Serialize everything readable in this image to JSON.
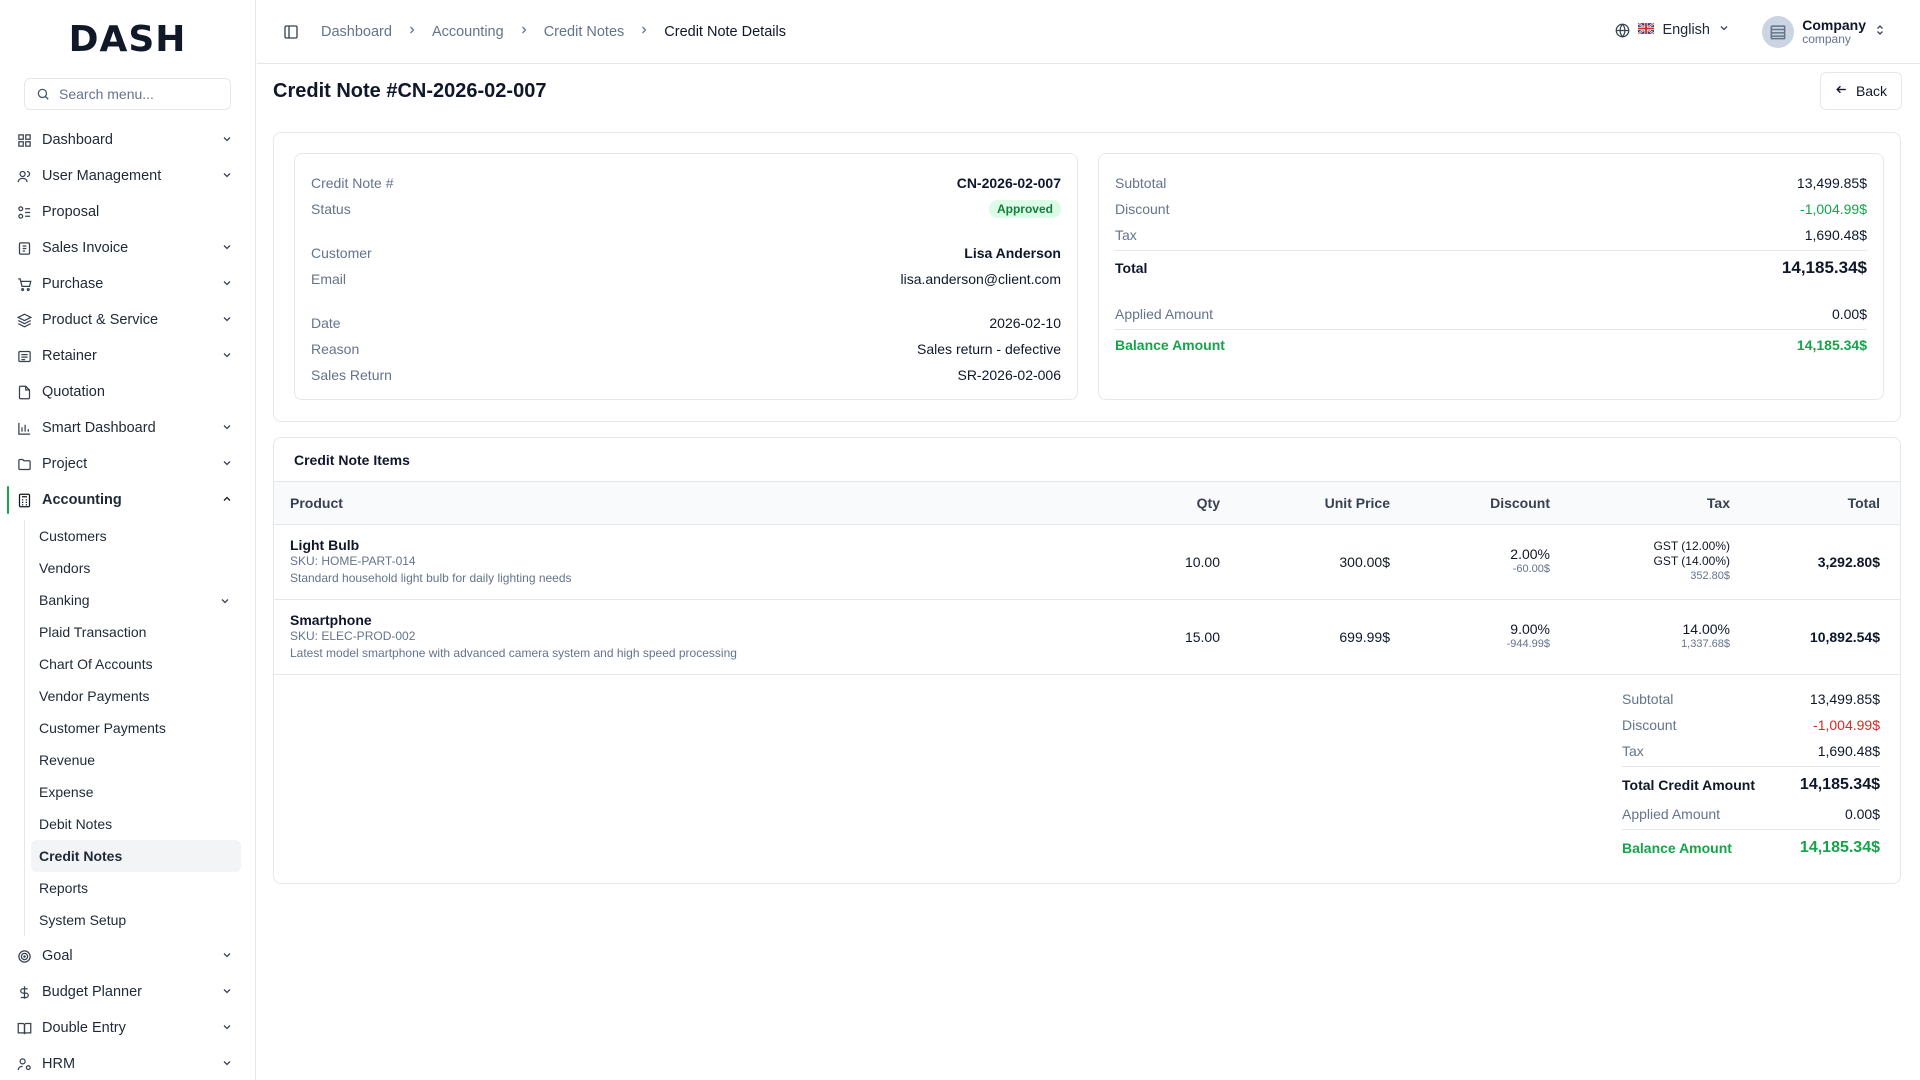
{
  "logo": "DASH",
  "search": {
    "placeholder": "Search menu..."
  },
  "sidebar": {
    "items": [
      {
        "label": "Dashboard"
      },
      {
        "label": "User Management"
      },
      {
        "label": "Proposal"
      },
      {
        "label": "Sales Invoice"
      },
      {
        "label": "Purchase"
      },
      {
        "label": "Product & Service"
      },
      {
        "label": "Retainer"
      },
      {
        "label": "Quotation"
      },
      {
        "label": "Smart Dashboard"
      },
      {
        "label": "Project"
      },
      {
        "label": "Accounting"
      },
      {
        "label": "Goal"
      },
      {
        "label": "Budget Planner"
      },
      {
        "label": "Double Entry"
      },
      {
        "label": "HRM"
      }
    ],
    "accounting_sub": [
      {
        "label": "Customers"
      },
      {
        "label": "Vendors"
      },
      {
        "label": "Banking"
      },
      {
        "label": "Plaid Transaction"
      },
      {
        "label": "Chart Of Accounts"
      },
      {
        "label": "Vendor Payments"
      },
      {
        "label": "Customer Payments"
      },
      {
        "label": "Revenue"
      },
      {
        "label": "Expense"
      },
      {
        "label": "Debit Notes"
      },
      {
        "label": "Credit Notes"
      },
      {
        "label": "Reports"
      },
      {
        "label": "System Setup"
      }
    ]
  },
  "breadcrumb": [
    "Dashboard",
    "Accounting",
    "Credit Notes",
    "Credit Note Details"
  ],
  "language": "English",
  "user": {
    "name": "Company",
    "role": "company"
  },
  "page": {
    "title": "Credit Note #CN-2026-02-007",
    "back": "Back"
  },
  "details": {
    "credit_note_label": "Credit Note #",
    "credit_note": "CN-2026-02-007",
    "status_label": "Status",
    "status": "Approved",
    "customer_label": "Customer",
    "customer": "Lisa Anderson",
    "email_label": "Email",
    "email": "lisa.anderson@client.com",
    "date_label": "Date",
    "date": "2026-02-10",
    "reason_label": "Reason",
    "reason": "Sales return - defective",
    "sales_return_label": "Sales Return",
    "sales_return": "SR-2026-02-006"
  },
  "summary": {
    "subtotal_label": "Subtotal",
    "subtotal": "13,499.85$",
    "discount_label": "Discount",
    "discount": "-1,004.99$",
    "tax_label": "Tax",
    "tax": "1,690.48$",
    "total_label": "Total",
    "total": "14,185.34$",
    "applied_label": "Applied Amount",
    "applied": "0.00$",
    "balance_label": "Balance Amount",
    "balance": "14,185.34$"
  },
  "items": {
    "title": "Credit Note Items",
    "headers": [
      "Product",
      "Qty",
      "Unit Price",
      "Discount",
      "Tax",
      "Total"
    ],
    "rows": [
      {
        "name": "Light Bulb",
        "sku": "SKU: HOME-PART-014",
        "desc": "Standard household light bulb for daily lighting needs",
        "qty": "10.00",
        "unit_price": "300.00$",
        "discount_pct": "2.00%",
        "discount_amt": "-60.00$",
        "tax1": "GST (12.00%)",
        "tax2": "GST (14.00%)",
        "tax_amt": "352.80$",
        "total": "3,292.80$"
      },
      {
        "name": "Smartphone",
        "sku": "SKU: ELEC-PROD-002",
        "desc": "Latest model smartphone with advanced camera system and high speed processing",
        "qty": "15.00",
        "unit_price": "699.99$",
        "discount_pct": "9.00%",
        "discount_amt": "-944.99$",
        "tax1": "14.00%",
        "tax_amt": "1,337.68$",
        "total": "10,892.54$"
      }
    ]
  },
  "totals": {
    "subtotal_label": "Subtotal",
    "subtotal": "13,499.85$",
    "discount_label": "Discount",
    "discount": "-1,004.99$",
    "tax_label": "Tax",
    "tax": "1,690.48$",
    "total_label": "Total Credit Amount",
    "total": "14,185.34$",
    "applied_label": "Applied Amount",
    "applied": "0.00$",
    "balance_label": "Balance Amount",
    "balance": "14,185.34$"
  },
  "colors": {
    "accent": "#16a34a",
    "negative": "#dc2626",
    "border": "#e5e7eb"
  }
}
